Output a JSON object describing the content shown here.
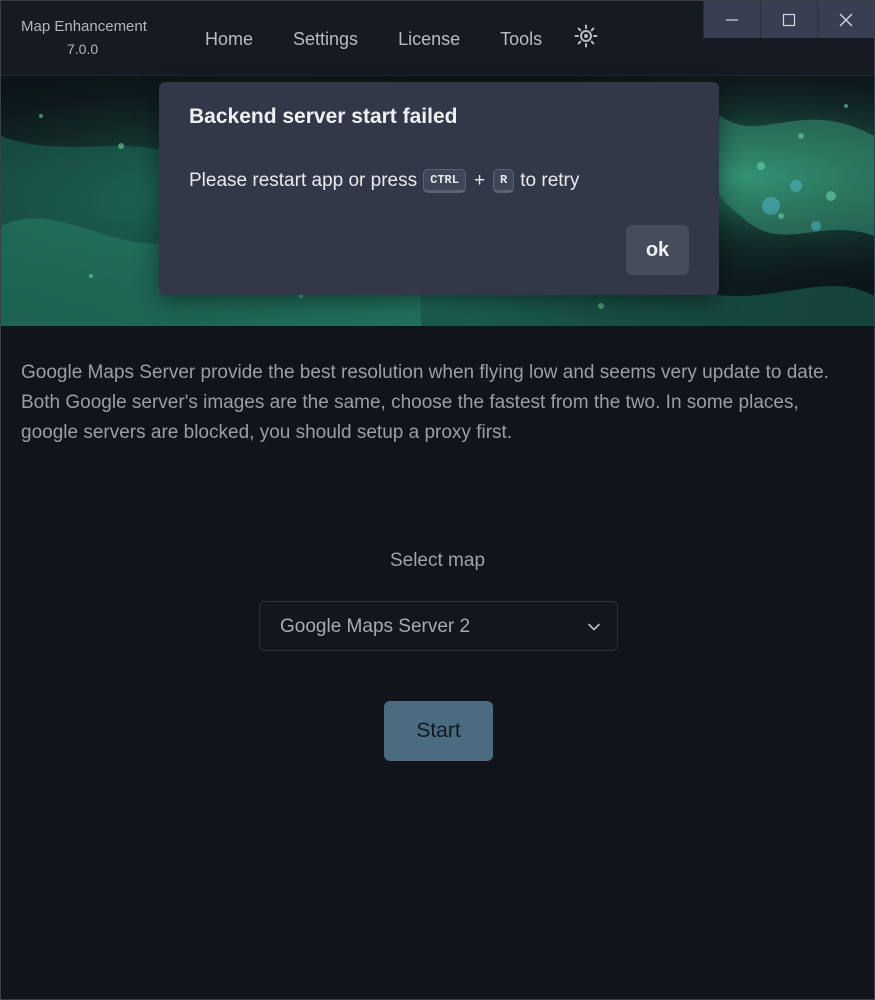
{
  "app": {
    "name": "Map Enhancement",
    "version": "7.0.0"
  },
  "nav": {
    "items": [
      "Home",
      "Settings",
      "License",
      "Tools"
    ],
    "theme_icon": "sun-icon"
  },
  "window_controls": [
    "minimize-icon",
    "maximize-icon",
    "close-icon"
  ],
  "main": {
    "description": "Google Maps Server provide the best resolution when flying low and seems very update to date. Both Google server's images are the same, choose the fastest from the two. In some places, google servers are blocked, you should setup a proxy first.",
    "select_label": "Select map",
    "selected_map": "Google Maps Server 2",
    "start_label": "Start"
  },
  "dialog": {
    "title": "Backend server start failed",
    "body_prefix": "Please restart app or press",
    "key1": "CTRL",
    "plus": "+",
    "key2": "R",
    "body_suffix": "to retry",
    "ok_label": "ok"
  },
  "colors": {
    "accent": "#4a6b80",
    "dialog_bg": "#323848",
    "page_bg": "#11141b"
  }
}
